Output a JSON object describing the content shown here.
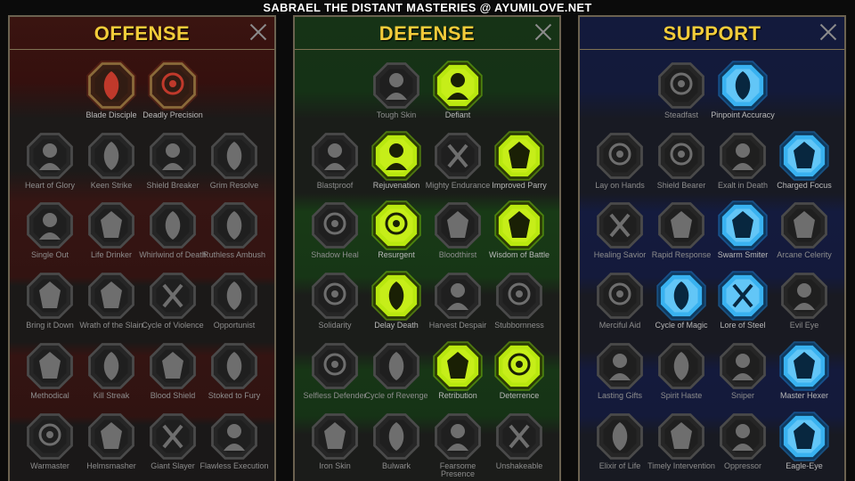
{
  "page_title": "SABRAEL THE DISTANT MASTERIES @ AYUMILOVE.NET",
  "panels": [
    {
      "id": "offense",
      "title": "OFFENSE",
      "accent": "#f2cc3a",
      "tiers": [
        {
          "start": 1,
          "items": [
            {
              "label": "Blade Disciple",
              "icon": "crossed-swords-icon",
              "state": "active-red"
            },
            {
              "label": "Deadly Precision",
              "icon": "daggers-icon",
              "state": "active-red"
            }
          ]
        },
        {
          "start": 0,
          "items": [
            {
              "label": "Heart of Glory",
              "icon": "helmed-figure-icon",
              "state": "locked"
            },
            {
              "label": "Keen Strike",
              "icon": "slash-icon",
              "state": "locked"
            },
            {
              "label": "Shield Breaker",
              "icon": "shield-breaker-icon",
              "state": "locked"
            },
            {
              "label": "Grim Resolve",
              "icon": "cracked-heart-icon",
              "state": "locked"
            }
          ]
        },
        {
          "start": 0,
          "items": [
            {
              "label": "Single Out",
              "icon": "target-fist-icon",
              "state": "locked"
            },
            {
              "label": "Life Drinker",
              "icon": "fangs-icon",
              "state": "locked"
            },
            {
              "label": "Whirlwind of Death",
              "icon": "whirlwind-skull-icon",
              "state": "locked"
            },
            {
              "label": "Ruthless Ambush",
              "icon": "dagger-hand-icon",
              "state": "locked"
            }
          ]
        },
        {
          "start": 0,
          "items": [
            {
              "label": "Bring it Down",
              "icon": "falling-blade-icon",
              "state": "locked"
            },
            {
              "label": "Wrath of the Slain",
              "icon": "fist-sword-icon",
              "state": "locked"
            },
            {
              "label": "Cycle of Violence",
              "icon": "axe-cycle-icon",
              "state": "locked"
            },
            {
              "label": "Opportunist",
              "icon": "chain-lightning-icon",
              "state": "locked"
            }
          ]
        },
        {
          "start": 0,
          "items": [
            {
              "label": "Methodical",
              "icon": "spider-icon",
              "state": "locked"
            },
            {
              "label": "Kill Streak",
              "icon": "skull-crossbones-icon",
              "state": "locked"
            },
            {
              "label": "Blood Shield",
              "icon": "sword-shield-icon",
              "state": "locked"
            },
            {
              "label": "Stoked to Fury",
              "icon": "raging-figure-icon",
              "state": "locked"
            }
          ]
        },
        {
          "start": 0,
          "items": [
            {
              "label": "Warmaster",
              "icon": "warrior-sword-icon",
              "state": "locked"
            },
            {
              "label": "Helmsmasher",
              "icon": "knight-helm-icon",
              "state": "locked"
            },
            {
              "label": "Giant Slayer",
              "icon": "horned-giant-icon",
              "state": "locked"
            },
            {
              "label": "Flawless Execution",
              "icon": "executioner-skull-icon",
              "state": "locked"
            }
          ]
        }
      ]
    },
    {
      "id": "defense",
      "title": "DEFENSE",
      "accent": "#f2cc3a",
      "tiers": [
        {
          "start": 1,
          "items": [
            {
              "label": "Tough Skin",
              "icon": "scales-icon",
              "state": "locked"
            },
            {
              "label": "Defiant",
              "icon": "raised-fist-icon",
              "state": "active-green"
            }
          ]
        },
        {
          "start": 0,
          "items": [
            {
              "label": "Blastproof",
              "icon": "layered-shield-icon",
              "state": "locked"
            },
            {
              "label": "Rejuvenation",
              "icon": "healing-heart-icon",
              "state": "active-green"
            },
            {
              "label": "Mighty Endurance",
              "icon": "muscle-figure-icon",
              "state": "locked"
            },
            {
              "label": "Improved Parry",
              "icon": "parry-swords-icon",
              "state": "active-green"
            }
          ]
        },
        {
          "start": 0,
          "items": [
            {
              "label": "Shadow Heal",
              "icon": "shadow-figure-icon",
              "state": "locked"
            },
            {
              "label": "Resurgent",
              "icon": "knight-shield-icon",
              "state": "active-green"
            },
            {
              "label": "Bloodthirst",
              "icon": "skull-heart-icon",
              "state": "locked"
            },
            {
              "label": "Wisdom of Battle",
              "icon": "wise-head-icon",
              "state": "active-green"
            }
          ]
        },
        {
          "start": 0,
          "items": [
            {
              "label": "Solidarity",
              "icon": "crowd-icon",
              "state": "locked"
            },
            {
              "label": "Delay Death",
              "icon": "hourglass-icon",
              "state": "active-green"
            },
            {
              "label": "Harvest Despair",
              "icon": "open-hand-icon",
              "state": "locked"
            },
            {
              "label": "Stubbornness",
              "icon": "bull-head-icon",
              "state": "locked"
            }
          ]
        },
        {
          "start": 0,
          "items": [
            {
              "label": "Selfless Defender",
              "icon": "running-defender-icon",
              "state": "locked"
            },
            {
              "label": "Cycle of Revenge",
              "icon": "flame-drops-icon",
              "state": "locked"
            },
            {
              "label": "Retribution",
              "icon": "burning-skull-icon",
              "state": "active-green"
            },
            {
              "label": "Deterrence",
              "icon": "deflect-hand-icon",
              "state": "active-green"
            }
          ]
        },
        {
          "start": 0,
          "items": [
            {
              "label": "Iron Skin",
              "icon": "armored-man-icon",
              "state": "locked"
            },
            {
              "label": "Bulwark",
              "icon": "tower-shield-icon",
              "state": "locked"
            },
            {
              "label": "Fearsome Presence",
              "icon": "demon-face-icon",
              "state": "locked"
            },
            {
              "label": "Unshakeable",
              "icon": "flexing-figure-icon",
              "state": "locked"
            }
          ]
        }
      ]
    },
    {
      "id": "support",
      "title": "SUPPORT",
      "accent": "#f2cc3a",
      "tiers": [
        {
          "start": 1,
          "items": [
            {
              "label": "Steadfast",
              "icon": "sparkling-heart-icon",
              "state": "locked"
            },
            {
              "label": "Pinpoint Accuracy",
              "icon": "bullseye-arrows-icon",
              "state": "active-blue"
            }
          ]
        },
        {
          "start": 0,
          "items": [
            {
              "label": "Lay on Hands",
              "icon": "praying-hands-icon",
              "state": "locked"
            },
            {
              "label": "Shield Bearer",
              "icon": "shield-arcs-icon",
              "state": "locked"
            },
            {
              "label": "Exalt in Death",
              "icon": "smoking-skull-icon",
              "state": "locked"
            },
            {
              "label": "Charged Focus",
              "icon": "charged-blast-icon",
              "state": "active-blue"
            }
          ]
        },
        {
          "start": 0,
          "items": [
            {
              "label": "Healing Savior",
              "icon": "glowing-figure-icon",
              "state": "locked"
            },
            {
              "label": "Rapid Response",
              "icon": "lightning-shield-icon",
              "state": "locked"
            },
            {
              "label": "Swarm Smiter",
              "icon": "swarm-bolt-icon",
              "state": "active-blue"
            },
            {
              "label": "Arcane Celerity",
              "icon": "twin-figures-icon",
              "state": "locked"
            }
          ]
        },
        {
          "start": 0,
          "items": [
            {
              "label": "Merciful Aid",
              "icon": "chained-heart-icon",
              "state": "locked"
            },
            {
              "label": "Cycle of Magic",
              "icon": "magic-comet-icon",
              "state": "active-blue"
            },
            {
              "label": "Lore of Steel",
              "icon": "open-book-icon",
              "state": "active-blue"
            },
            {
              "label": "Evil Eye",
              "icon": "evil-eye-icon",
              "state": "locked"
            }
          ]
        },
        {
          "start": 0,
          "items": [
            {
              "label": "Lasting Gifts",
              "icon": "compass-star-icon",
              "state": "locked"
            },
            {
              "label": "Spirit Haste",
              "icon": "winged-boot-icon",
              "state": "locked"
            },
            {
              "label": "Sniper",
              "icon": "sniper-eye-icon",
              "state": "locked"
            },
            {
              "label": "Master Hexer",
              "icon": "hex-rune-icon",
              "state": "active-blue"
            }
          ]
        },
        {
          "start": 0,
          "items": [
            {
              "label": "Elixir of Life",
              "icon": "potion-flask-icon",
              "state": "locked"
            },
            {
              "label": "Timely Intervention",
              "icon": "hooded-skull-icon",
              "state": "locked"
            },
            {
              "label": "Oppressor",
              "icon": "crushing-fist-icon",
              "state": "locked"
            },
            {
              "label": "Eagle-Eye",
              "icon": "eagle-head-icon",
              "state": "active-blue"
            }
          ]
        }
      ]
    }
  ]
}
